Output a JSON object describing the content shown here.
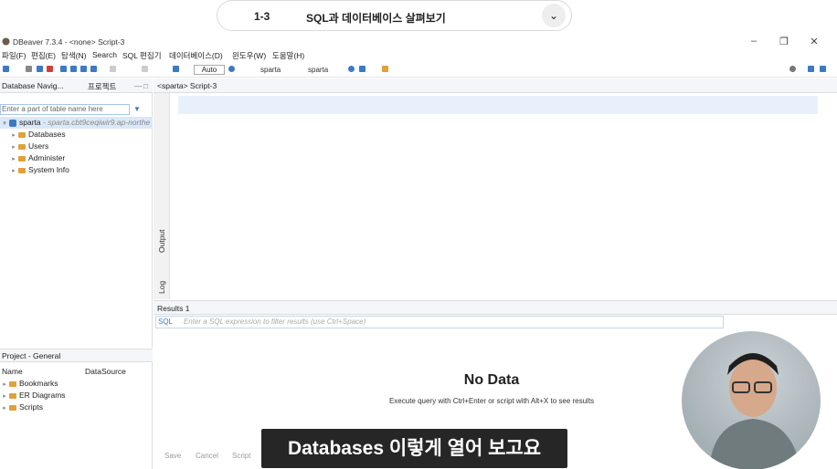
{
  "lesson": {
    "number": "1-3",
    "title": "SQL과 데이터베이스 살펴보기"
  },
  "window": {
    "title": "DBeaver 7.3.4 - <none> Script-3"
  },
  "menu": [
    "파일(F)",
    "편집(E)",
    "탐색(N)",
    "Search",
    "SQL 편집기",
    "데이터베이스(D)",
    "윈도우(W)",
    "도움말(H)"
  ],
  "toolbar": {
    "transaction_mode": "Auto",
    "datasource": "sparta",
    "schema": "sparta"
  },
  "navigator": {
    "tab_label": "Database Navig...",
    "tab_projects": "프로젝트",
    "filter_placeholder": "Enter a part of table name here",
    "connection": {
      "name": "sparta",
      "host": "- sparta.cbt9ceqiwir9.ap-northe"
    },
    "items": [
      "Databases",
      "Users",
      "Administer",
      "System Info"
    ]
  },
  "project": {
    "tab_label": "Project - General",
    "col_name": "Name",
    "col_source": "DataSource",
    "items": [
      "Bookmarks",
      "ER Diagrams",
      "Scripts"
    ]
  },
  "editor": {
    "tab_label": "<sparta> Script-3",
    "side_output": "Output",
    "side_log": "Log"
  },
  "results": {
    "tab_label": "Results 1",
    "filter_prefix": "SQL",
    "filter_placeholder": "Enter a SQL expression to filter results (use Ctrl+Space)",
    "empty_title": "No Data",
    "empty_hint": "Execute query with Ctrl+Enter or script with Alt+X to see results",
    "save": "Save",
    "cancel": "Cancel",
    "script": "Script"
  },
  "subtitle": "Databases 이렇게 열어 보고요",
  "colors": {
    "accent": "#3c7ac8",
    "folder": "#e0a13a",
    "selection": "#dbe8f7"
  }
}
